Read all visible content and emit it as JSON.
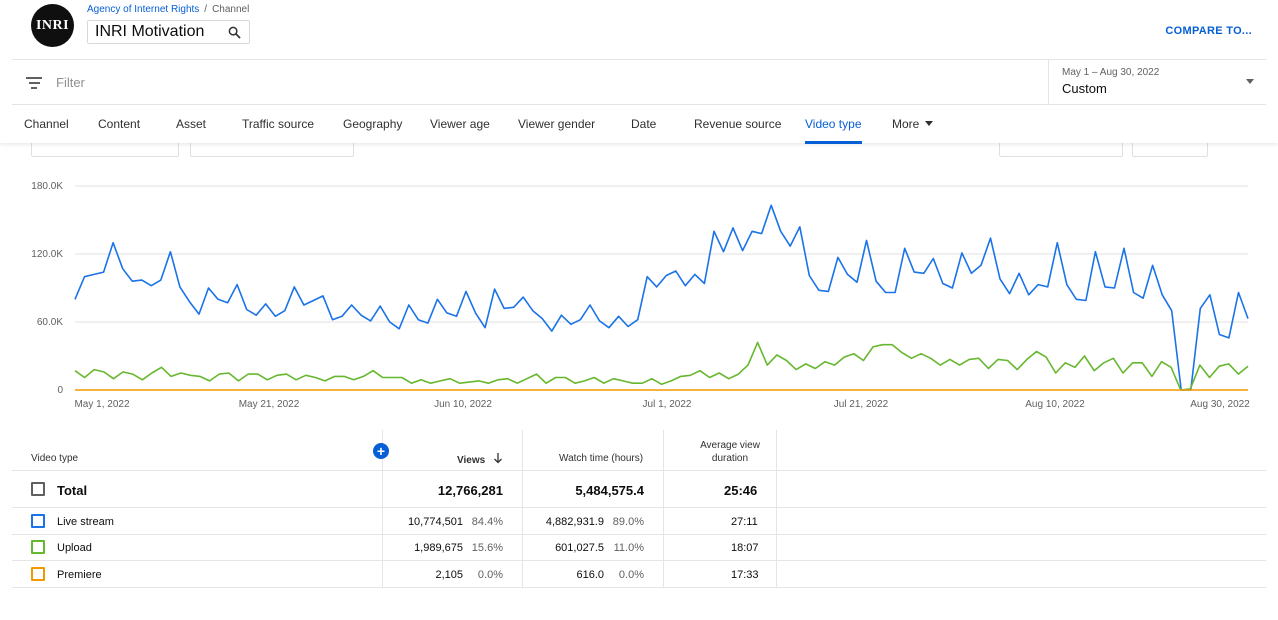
{
  "header": {
    "logo_text": "INRI",
    "breadcrumb": {
      "parent": "Agency of Internet Rights",
      "current": "Channel"
    },
    "channel_name": "INRI Motivation",
    "compare_label": "COMPARE TO..."
  },
  "filter": {
    "placeholder": "Filter",
    "date_range": "May 1 – Aug 30, 2022",
    "date_preset": "Custom"
  },
  "tabs": [
    {
      "label": "Channel"
    },
    {
      "label": "Content"
    },
    {
      "label": "Asset"
    },
    {
      "label": "Traffic source"
    },
    {
      "label": "Geography"
    },
    {
      "label": "Viewer age"
    },
    {
      "label": "Viewer gender"
    },
    {
      "label": "Date"
    },
    {
      "label": "Revenue source"
    },
    {
      "label": "Video type",
      "active": true
    },
    {
      "label": "More"
    }
  ],
  "colors": {
    "live_stream": "#1a73e8",
    "upload": "#67b72f",
    "premiere": "#f29900",
    "accent": "#065fd4"
  },
  "chart_data": {
    "type": "line",
    "y_ticks": [
      "180.0K",
      "120.0K",
      "60.0K",
      "0"
    ],
    "ylim": [
      0,
      180000
    ],
    "x_tick_labels": [
      "May 1, 2022",
      "May 21, 2022",
      "Jun 10, 2022",
      "Jul 1, 2022",
      "Jul 21, 2022",
      "Aug 10, 2022",
      "Aug 30, 2022"
    ],
    "series": [
      {
        "name": "Live stream",
        "color": "#1a73e8",
        "values": [
          80000,
          100000,
          102000,
          104000,
          130000,
          107000,
          96000,
          97000,
          92000,
          97000,
          122000,
          91000,
          78000,
          67000,
          90000,
          80000,
          77000,
          93000,
          71000,
          66000,
          76000,
          65000,
          70000,
          91000,
          75000,
          79000,
          83000,
          62000,
          65000,
          75000,
          66000,
          61000,
          74000,
          60000,
          54000,
          75000,
          62000,
          59000,
          80000,
          68000,
          65000,
          87000,
          68000,
          55000,
          89000,
          72000,
          73000,
          82000,
          70000,
          63000,
          52000,
          66000,
          58000,
          62000,
          75000,
          61000,
          55000,
          65000,
          56000,
          62000,
          100000,
          91000,
          101000,
          105000,
          92000,
          102000,
          94000,
          140000,
          122000,
          143000,
          123000,
          140000,
          138000,
          163000,
          140000,
          127000,
          144000,
          101000,
          88000,
          87000,
          117000,
          102000,
          95000,
          132000,
          96000,
          86000,
          86000,
          125000,
          104000,
          103000,
          116000,
          94000,
          90000,
          121000,
          103000,
          110000,
          134000,
          98000,
          85000,
          103000,
          84000,
          93000,
          91000,
          130000,
          93000,
          80000,
          79000,
          122000,
          91000,
          90000,
          125000,
          86000,
          81000,
          110000,
          84000,
          70000,
          0,
          0,
          72000,
          84000,
          49000,
          46000,
          86000,
          63000
        ]
      },
      {
        "name": "Upload",
        "color": "#67b72f",
        "values": [
          17000,
          11000,
          18000,
          16000,
          10000,
          16000,
          14000,
          9000,
          15000,
          20000,
          12000,
          15000,
          13000,
          12000,
          8000,
          14000,
          15000,
          8000,
          14000,
          14000,
          9000,
          13000,
          14000,
          9000,
          13000,
          11000,
          8000,
          12000,
          12000,
          9000,
          12000,
          17000,
          11000,
          11000,
          11000,
          6000,
          9000,
          6000,
          8000,
          10000,
          6000,
          7000,
          8000,
          6000,
          9000,
          10000,
          6000,
          10000,
          14000,
          6000,
          11000,
          11000,
          6000,
          8000,
          11000,
          6000,
          10000,
          8000,
          6000,
          6000,
          10000,
          5000,
          8000,
          12000,
          13000,
          17000,
          11000,
          15000,
          10000,
          14000,
          22000,
          42000,
          22000,
          31000,
          26000,
          18000,
          23000,
          19000,
          25000,
          22000,
          29000,
          32000,
          26000,
          38000,
          40000,
          40000,
          33000,
          28000,
          32000,
          28000,
          22000,
          27000,
          22000,
          27000,
          28000,
          19000,
          27000,
          26000,
          18000,
          27000,
          34000,
          29000,
          15000,
          24000,
          20000,
          30000,
          17000,
          24000,
          28000,
          15000,
          24000,
          24000,
          12000,
          25000,
          20000,
          0,
          1000,
          22000,
          11000,
          21000,
          23000,
          14000,
          21000
        ]
      },
      {
        "name": "Premiere",
        "color": "#f29900",
        "values": [
          0,
          0,
          0,
          0,
          0,
          0,
          0,
          0,
          0,
          0,
          0,
          0,
          0,
          0,
          0,
          0,
          0,
          0,
          0,
          0,
          0,
          0,
          0,
          0,
          0,
          0,
          0,
          0,
          0,
          0,
          0,
          0,
          0,
          0,
          0,
          0,
          0,
          0,
          0,
          0,
          0,
          0,
          0,
          0,
          0,
          0,
          0,
          0,
          0,
          0,
          0,
          0,
          0,
          0,
          0,
          0,
          0,
          0,
          0,
          0,
          0,
          0,
          0,
          0,
          0,
          0,
          0,
          0,
          0,
          0,
          0,
          0,
          0,
          0,
          0,
          0,
          0,
          0,
          0,
          0,
          0,
          0,
          0,
          0,
          0,
          0,
          0,
          0,
          0,
          0,
          0,
          0,
          0,
          0,
          0,
          0,
          0,
          0,
          0,
          0,
          0,
          0,
          0,
          0,
          0,
          0,
          0,
          0,
          0,
          0,
          0,
          0,
          0,
          0,
          0,
          0,
          0,
          0,
          0,
          0,
          0,
          0,
          0
        ]
      }
    ]
  },
  "table": {
    "headers": {
      "video_type": "Video type",
      "views": "Views",
      "watch_time": "Watch time (hours)",
      "avg_view_1": "Average view",
      "avg_view_2": "duration"
    },
    "total": {
      "label": "Total",
      "views": "12,766,281",
      "watch_time": "5,484,575.4",
      "avg": "25:46"
    },
    "rows": [
      {
        "label": "Live stream",
        "views": "10,774,501",
        "views_pct": "84.4%",
        "watch_time": "4,882,931.9",
        "watch_pct": "89.0%",
        "avg": "27:11",
        "color": "#1a73e8"
      },
      {
        "label": "Upload",
        "views": "1,989,675",
        "views_pct": "15.6%",
        "watch_time": "601,027.5",
        "watch_pct": "11.0%",
        "avg": "18:07",
        "color": "#67b72f"
      },
      {
        "label": "Premiere",
        "views": "2,105",
        "views_pct": "0.0%",
        "watch_time": "616.0",
        "watch_pct": "0.0%",
        "avg": "17:33",
        "color": "#f29900"
      }
    ]
  }
}
